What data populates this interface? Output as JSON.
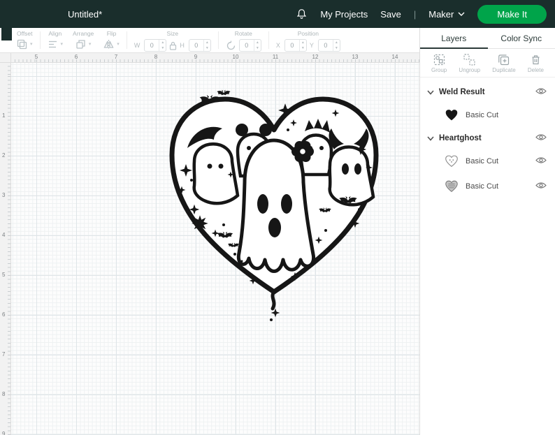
{
  "header": {
    "title": "Untitled*",
    "my_projects": "My Projects",
    "save": "Save",
    "divider": "|",
    "machine": "Maker",
    "make_it": "Make It",
    "header_bg": "#1a2e2c",
    "accent_green": "#00A44A"
  },
  "toolbar": {
    "offset": {
      "label": "Offset"
    },
    "align": {
      "label": "Align"
    },
    "arrange": {
      "label": "Arrange"
    },
    "flip": {
      "label": "Flip"
    },
    "size": {
      "label": "Size",
      "w_label": "W",
      "h_label": "H",
      "w_value": "0",
      "h_value": "0"
    },
    "rotate": {
      "label": "Rotate",
      "value": "0"
    },
    "position": {
      "label": "Position",
      "x_label": "X",
      "y_label": "Y",
      "x_value": "0",
      "y_value": "0"
    }
  },
  "rulers": {
    "h_numbers": [
      "5",
      "6",
      "7",
      "8",
      "9",
      "10",
      "11",
      "12",
      "13",
      "14"
    ],
    "v_numbers": [
      "1",
      "2",
      "3",
      "4",
      "5",
      "6",
      "7",
      "8",
      "9"
    ]
  },
  "canvas": {
    "artwork_name": "heart-of-ghosts-design"
  },
  "panel": {
    "tabs": {
      "layers": "Layers",
      "color_sync": "Color Sync"
    },
    "actions": [
      {
        "label": "Group"
      },
      {
        "label": "Ungroup"
      },
      {
        "label": "Duplicate"
      },
      {
        "label": "Delete"
      }
    ],
    "layers": [
      {
        "type": "group",
        "label": "Weld Result"
      },
      {
        "type": "item",
        "label": "Basic Cut"
      },
      {
        "type": "group",
        "label": "Heartghost"
      },
      {
        "type": "item",
        "label": "Basic Cut"
      },
      {
        "type": "item",
        "label": "Basic Cut"
      }
    ]
  }
}
